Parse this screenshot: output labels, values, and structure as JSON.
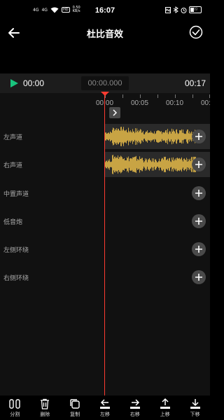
{
  "status_bar": {
    "network": "4G",
    "network2": "4G",
    "hd": "HD",
    "speed": "0.50",
    "speed_unit": "KB/s",
    "clock": "16:07",
    "battery": "39"
  },
  "header": {
    "title": "杜比音效"
  },
  "transport": {
    "current_time": "00:00",
    "position": "00:00.000",
    "end_time": "00:17"
  },
  "ruler": {
    "ticks": [
      "00:00",
      "00:05",
      "00:10",
      "00:"
    ]
  },
  "tracks": [
    {
      "label": "左声道",
      "has_audio": true
    },
    {
      "label": "右声道",
      "has_audio": true
    },
    {
      "label": "中置声道",
      "has_audio": false
    },
    {
      "label": "低音炮",
      "has_audio": false
    },
    {
      "label": "左侧环绕",
      "has_audio": false
    },
    {
      "label": "右侧环绕",
      "has_audio": false
    }
  ],
  "toolbar": [
    {
      "label": "分割",
      "icon": "split-icon"
    },
    {
      "label": "删除",
      "icon": "trash-icon"
    },
    {
      "label": "复制",
      "icon": "copy-icon"
    },
    {
      "label": "左移",
      "icon": "move-left-icon"
    },
    {
      "label": "右移",
      "icon": "move-right-icon"
    },
    {
      "label": "上移",
      "icon": "move-up-icon"
    },
    {
      "label": "下移",
      "icon": "move-down-icon"
    }
  ],
  "colors": {
    "accent_play": "#19c37d",
    "playhead": "#ff3b30",
    "waveform": "#f0c24b"
  }
}
